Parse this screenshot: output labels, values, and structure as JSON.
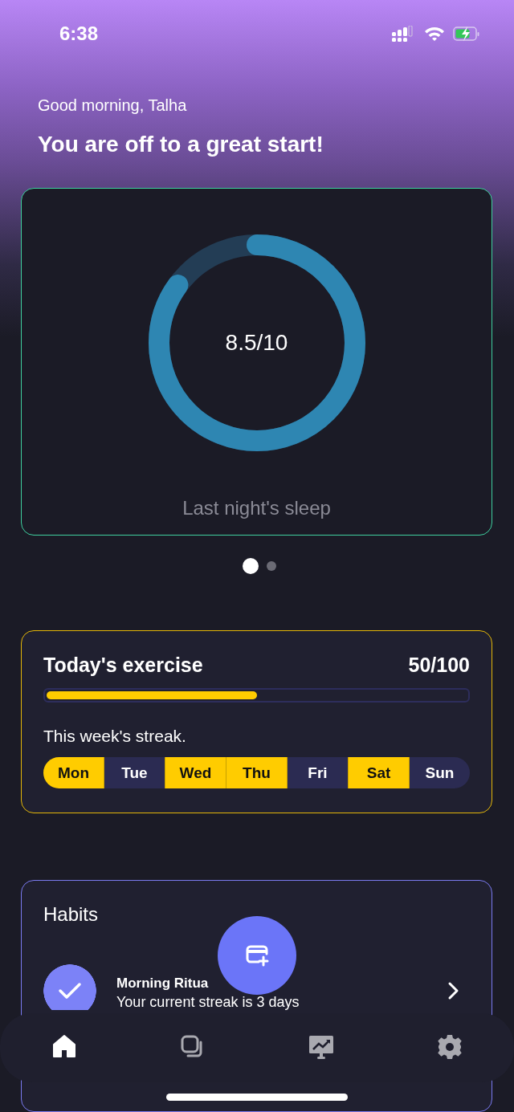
{
  "status_bar": {
    "time": "6:38"
  },
  "greeting": "Good morning, Talha",
  "headline": "You are off to a great start!",
  "sleep_card": {
    "score": "8.5/10",
    "level": 0.85,
    "label": "Last night's sleep"
  },
  "carousel_dots": [
    {
      "selected": true
    },
    {
      "selected": false
    }
  ],
  "exercise": {
    "title": "Today's exercise",
    "count": "50/100",
    "level": 0.5,
    "streak_label": "This week's streak.",
    "days": [
      {
        "label": "Mon",
        "done": true
      },
      {
        "label": "Tue",
        "done": false
      },
      {
        "label": "Wed",
        "done": true
      },
      {
        "label": "Thu",
        "done": true
      },
      {
        "label": "Fri",
        "done": false
      },
      {
        "label": "Sat",
        "done": true
      },
      {
        "label": "Sun",
        "done": false
      }
    ]
  },
  "habits": {
    "title": "Habits",
    "items": [
      {
        "name": "Morning Ritua",
        "detail": "Your current streak is 3 days",
        "checked": true
      }
    ]
  },
  "nav": [
    {
      "kind": "home",
      "selected": true
    },
    {
      "kind": "cards",
      "selected": false
    },
    {
      "kind": "chart",
      "selected": false
    },
    {
      "kind": "settings",
      "selected": false
    }
  ]
}
